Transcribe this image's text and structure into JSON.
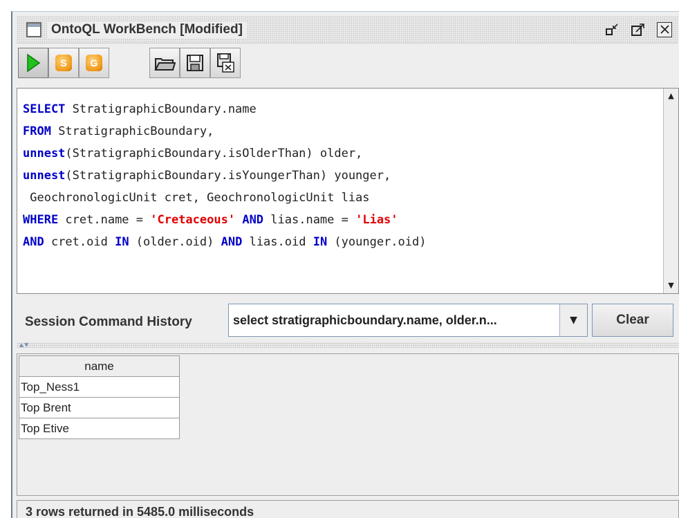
{
  "window": {
    "title": "OntoQL WorkBench [Modified]",
    "controls": {
      "minimize_icon": "minimize-icon",
      "maximize_icon": "maximize-icon",
      "close_icon": "close-icon"
    }
  },
  "toolbar": {
    "buttons": [
      {
        "icon": "play-icon"
      },
      {
        "icon": "s-coin-icon",
        "glyph": "S"
      },
      {
        "icon": "g-coin-icon",
        "glyph": "G"
      },
      {
        "icon": "open-folder-icon"
      },
      {
        "icon": "save-floppy-icon"
      },
      {
        "icon": "save-as-excel-icon"
      }
    ]
  },
  "editor": {
    "lines": [
      [
        {
          "t": "SELECT",
          "k": true
        },
        {
          "t": " StratigraphicBoundary.name"
        }
      ],
      [
        {
          "t": "FROM",
          "k": true
        },
        {
          "t": " StratigraphicBoundary,"
        }
      ],
      [
        {
          "t": "unnest",
          "k": true
        },
        {
          "t": "(StratigraphicBoundary.isOlderThan) older,"
        }
      ],
      [
        {
          "t": "unnest",
          "k": true
        },
        {
          "t": "(StratigraphicBoundary.isYoungerThan) younger,"
        }
      ],
      [
        {
          "t": " GeochronologicUnit cret, GeochronologicUnit lias"
        }
      ],
      [
        {
          "t": "WHERE",
          "k": true
        },
        {
          "t": " cret.name = "
        },
        {
          "t": "'Cretaceous'",
          "s": true
        },
        {
          "t": " "
        },
        {
          "t": "AND",
          "k": true
        },
        {
          "t": " lias.name = "
        },
        {
          "t": "'Lias'",
          "s": true
        }
      ],
      [
        {
          "t": "AND",
          "k": true
        },
        {
          "t": " cret.oid "
        },
        {
          "t": "IN",
          "k": true
        },
        {
          "t": " (older.oid) "
        },
        {
          "t": "AND",
          "k": true
        },
        {
          "t": " lias.oid "
        },
        {
          "t": "IN",
          "k": true
        },
        {
          "t": " (younger.oid)"
        }
      ]
    ],
    "colors": {
      "keyword": "#0000c8",
      "string": "#e00000"
    }
  },
  "history": {
    "label": "Session Command History",
    "selected": "select stratigraphicboundary.name, older.n...",
    "clear_label": "Clear"
  },
  "results": {
    "columns": [
      "name"
    ],
    "rows": [
      [
        "Top_Ness1"
      ],
      [
        "Top Brent"
      ],
      [
        "Top Etive"
      ]
    ]
  },
  "status": {
    "text": "3 rows returned in 5485.0 milliseconds"
  }
}
